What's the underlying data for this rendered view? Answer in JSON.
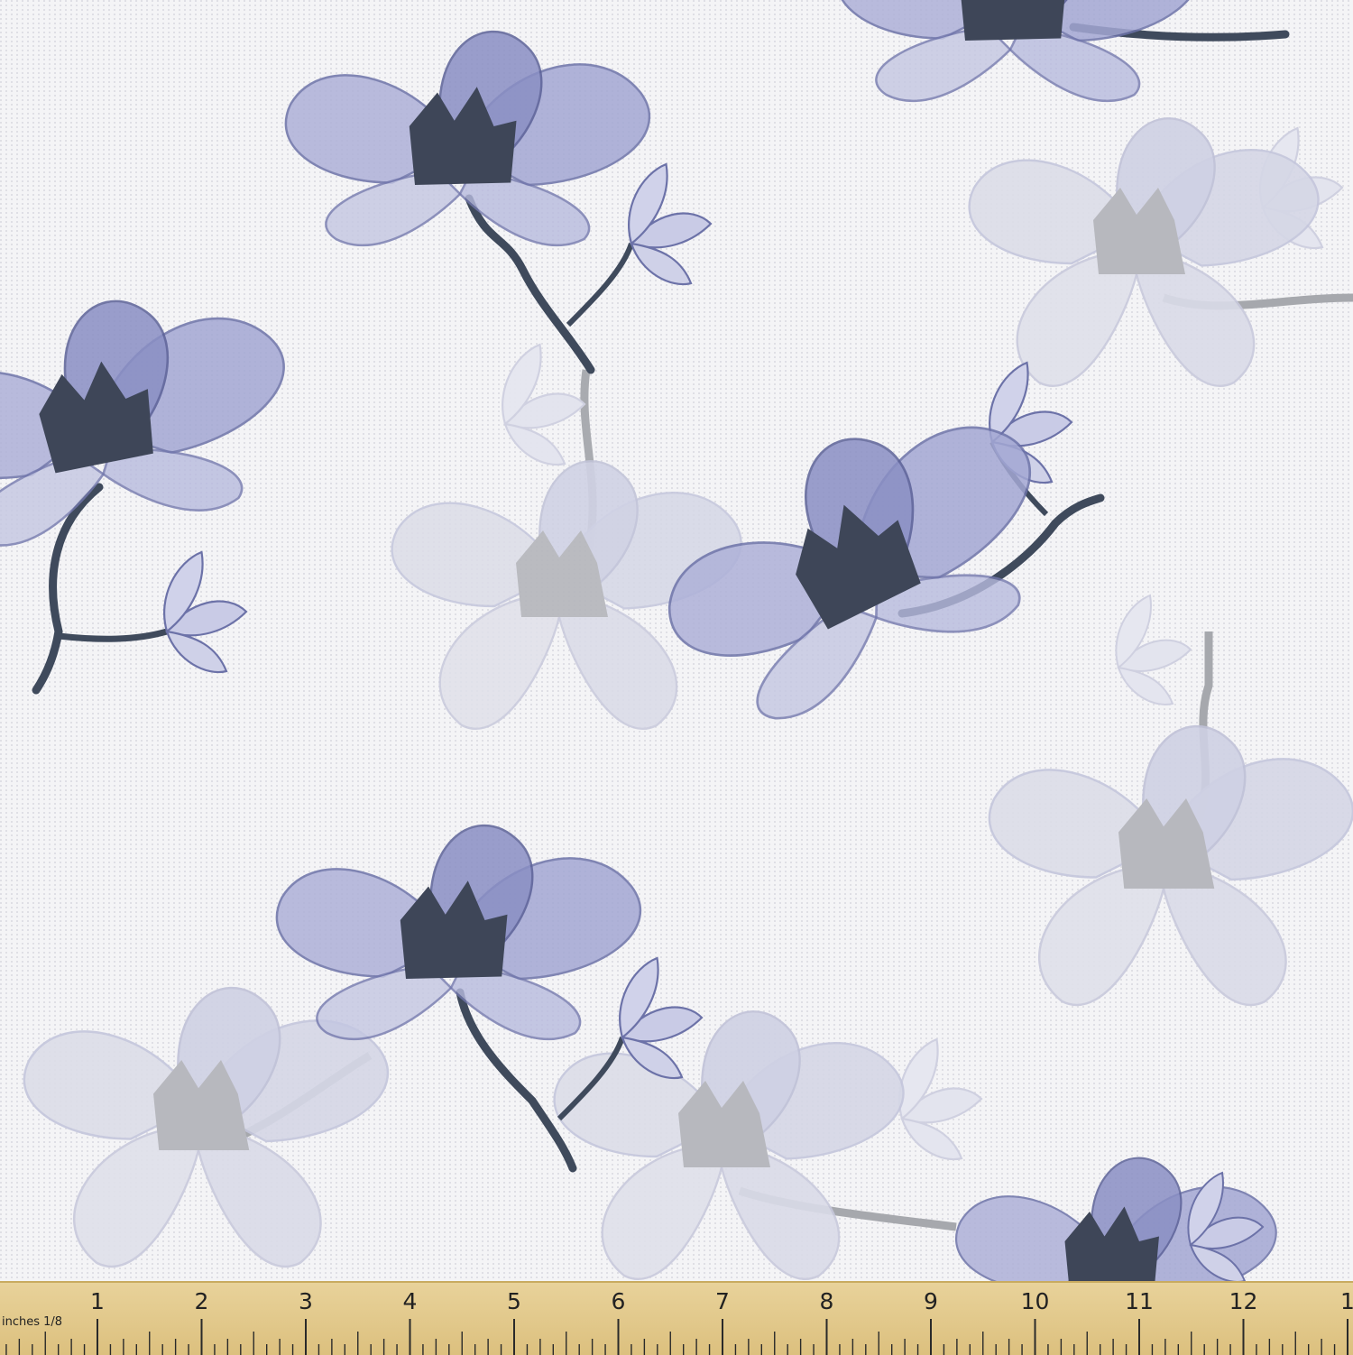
{
  "image": {
    "subject": "fabric swatch with floral print",
    "colors": {
      "background": "#f4f4f6",
      "petal_blue": "#8a8fc4",
      "petal_light": "#c4c7e2",
      "petal_ghost": "#d9dae6",
      "center_dark": "#3e4658",
      "stem_dark": "#3f4a5c",
      "stem_grey": "#a6a8ad",
      "ruler": "#e3c98a"
    }
  },
  "ruler": {
    "unit_label": "inches 1/8",
    "numbers": [
      "1",
      "2",
      "3",
      "4",
      "5",
      "6",
      "7",
      "8",
      "9",
      "10",
      "11",
      "12",
      "1"
    ]
  }
}
